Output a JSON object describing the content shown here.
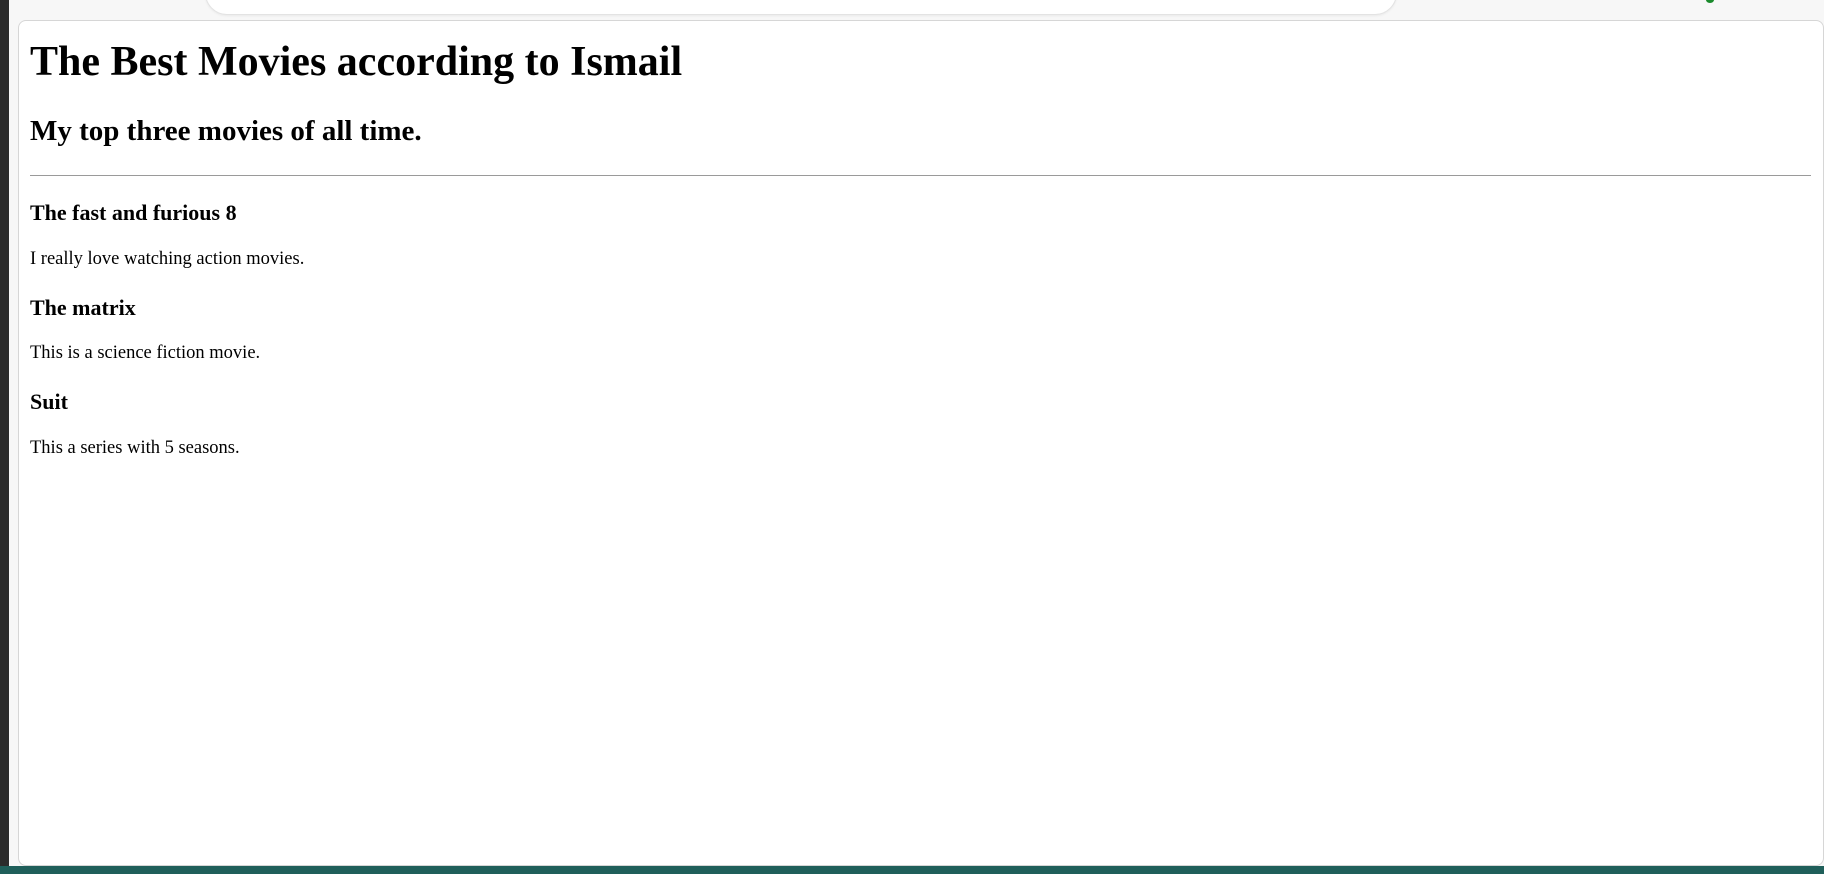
{
  "page": {
    "title": "The Best Movies according to Ismail",
    "subtitle": "My top three movies of all time."
  },
  "movies": [
    {
      "name": "The fast and furious 8",
      "description": "I really love watching action movies."
    },
    {
      "name": "The matrix",
      "description": "This is a science fiction movie."
    },
    {
      "name": "Suit",
      "description": "This a series with 5 seasons."
    }
  ],
  "colors": {
    "page_background": "#ffffff",
    "text": "#000000",
    "divider": "#9a9a9a",
    "taskbar": "#1f5f5a"
  }
}
